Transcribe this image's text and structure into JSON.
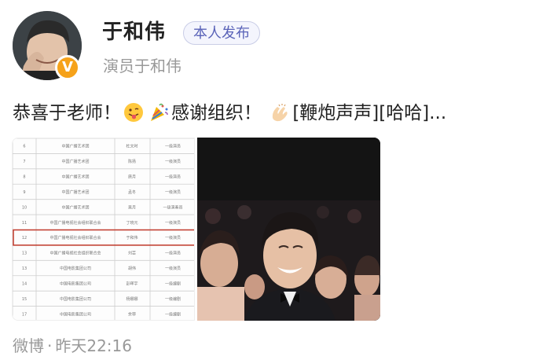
{
  "user": {
    "name": "于和伟",
    "tag": "本人发布",
    "subtitle": "演员于和伟",
    "verified_badge": "V"
  },
  "post": {
    "part1": "恭喜于老师！",
    "part2": "感谢组织！",
    "part3": "[鞭炮声声][哈哈]...",
    "emojis": [
      "tongue-face-icon",
      "party-popper-icon",
      "clapping-hands-icon"
    ]
  },
  "images": {
    "left_table_rows": [
      {
        "no": "6",
        "org": "中国广播艺术团",
        "name": "杜文时",
        "level": "一级演员"
      },
      {
        "no": "7",
        "org": "中国广播艺术团",
        "name": "陈扬",
        "level": "一级演员"
      },
      {
        "no": "8",
        "org": "中国广播艺术团",
        "name": "唐月",
        "level": "一级演员"
      },
      {
        "no": "9",
        "org": "中国广播艺术团",
        "name": "孟冬",
        "level": "一级演员"
      },
      {
        "no": "10",
        "org": "中国广播艺术团",
        "name": "吴月",
        "level": "一级演奏员"
      },
      {
        "no": "11",
        "org": "中国广播电视社会组织联合会",
        "name": "丁晓元",
        "level": "一级演员"
      },
      {
        "no": "12",
        "org": "中国广播电视社会组织联合会",
        "name": "于和伟",
        "level": "一级演员"
      },
      {
        "no": "13",
        "org": "中国广播电视社会组织联合会",
        "name": "刘芸",
        "level": "一级演员"
      },
      {
        "no": "13",
        "org": "中国电影集团公司",
        "name": "胡伟",
        "level": "一级演员"
      },
      {
        "no": "14",
        "org": "中国电影集团公司",
        "name": "彭晖宇",
        "level": "一级编剧"
      },
      {
        "no": "15",
        "org": "中国电影集团公司",
        "name": "杨娜娜",
        "level": "一级编剧"
      },
      {
        "no": "17",
        "org": "中国电影集团公司",
        "name": "余菲",
        "level": "一级编剧"
      }
    ]
  },
  "footer": {
    "source": "微博",
    "dot": "·",
    "time": "昨天22:16"
  },
  "colors": {
    "tag_text": "#5a63b8",
    "badge": "#f6a21a",
    "highlight": "#c0392b"
  }
}
